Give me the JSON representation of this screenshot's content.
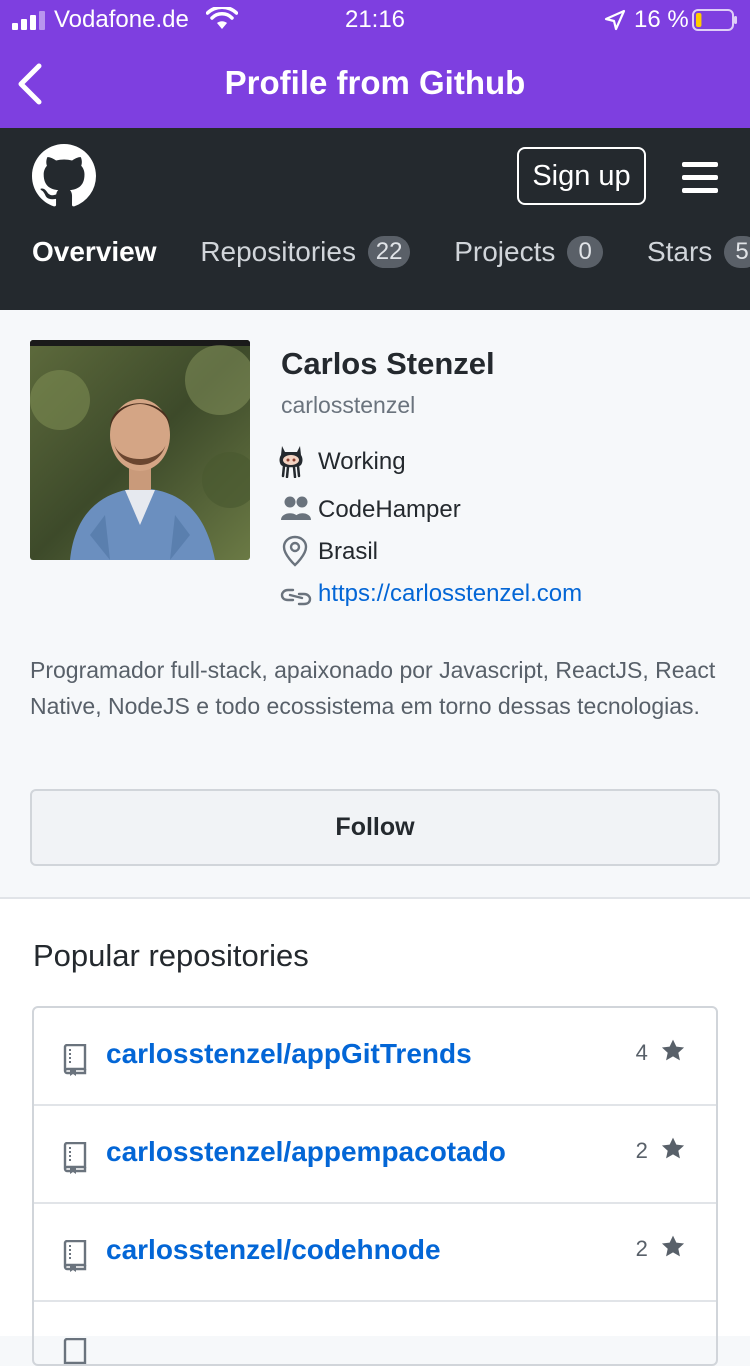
{
  "status_bar": {
    "carrier": "Vodafone.de",
    "time": "21:16",
    "battery": "16 %",
    "battery_level": 0.16,
    "icons": [
      "signal-icon",
      "wifi-icon",
      "location-arrow-icon",
      "battery-icon"
    ]
  },
  "navbar": {
    "title": "Profile from Github",
    "back_icon": "chevron-left-icon"
  },
  "github_header": {
    "logo_icon": "github-octocat-icon",
    "signup_label": "Sign up",
    "menu_icon": "hamburger-menu-icon",
    "tabs": [
      {
        "label": "Overview",
        "count": null,
        "active": true
      },
      {
        "label": "Repositories",
        "count": "22"
      },
      {
        "label": "Projects",
        "count": "0"
      },
      {
        "label": "Stars",
        "count": "5"
      }
    ]
  },
  "profile": {
    "name": "Carlos Stenzel",
    "username": "carlosstenzel",
    "status": "Working",
    "organization": "CodeHamper",
    "location": "Brasil",
    "website": "https://carlosstenzel.com",
    "bio": "Programador full-stack, apaixonado por Javascript, ReactJS, React Native, NodeJS e todo ecossistema em torno dessas tecnologias.",
    "follow_label": "Follow"
  },
  "popular": {
    "title": "Popular repositories",
    "repos": [
      {
        "name": "carlosstenzel/appGitTrends",
        "stars": "4"
      },
      {
        "name": "carlosstenzel/appempacotado",
        "stars": "2"
      },
      {
        "name": "carlosstenzel/codehnode",
        "stars": "2"
      }
    ]
  },
  "colors": {
    "accent": "#7e3fe0",
    "header_dark": "#24292e",
    "link": "#0366d6"
  }
}
